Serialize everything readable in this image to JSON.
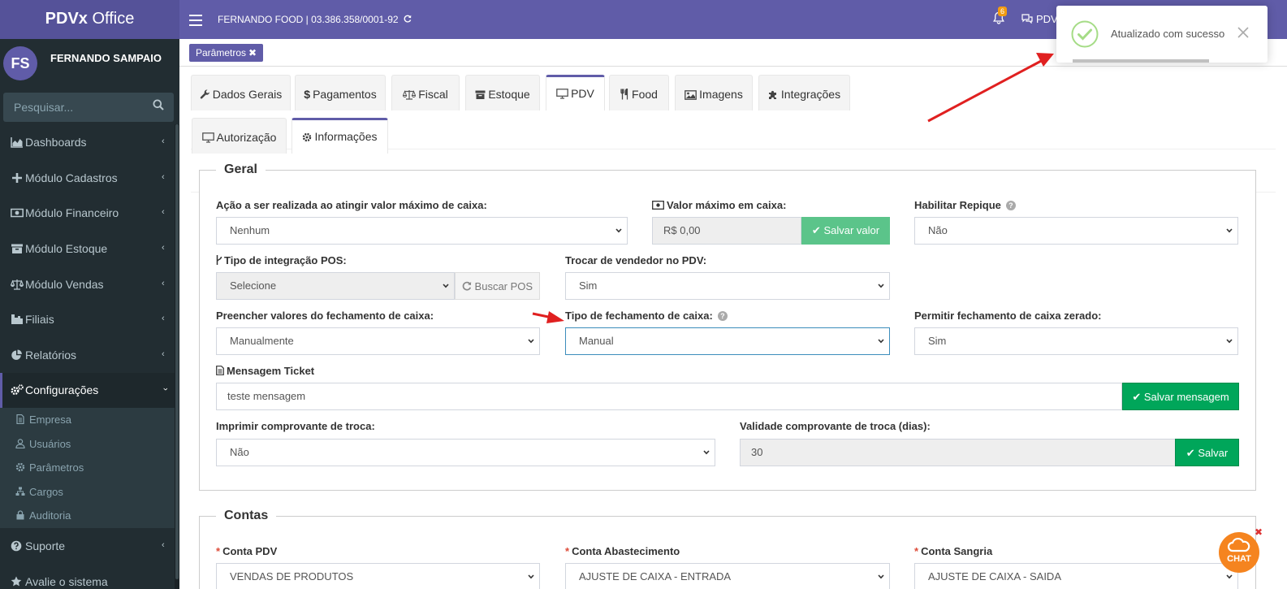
{
  "header": {
    "logo_bold": "PDVx",
    "logo_rest": " Office",
    "company": "FERNANDO FOOD | 03.386.358/0001-92",
    "notification_count": "6",
    "user_short": "PDVi"
  },
  "sidebar": {
    "avatar_initials": "FS",
    "user_name": "FERNANDO SAMPAIO",
    "search_placeholder": "Pesquisar...",
    "items": [
      {
        "label": "Dashboards",
        "icon": "area-chart-icon"
      },
      {
        "label": "Módulo Cadastros",
        "icon": "plus-icon"
      },
      {
        "label": "Módulo Financeiro",
        "icon": "money-icon"
      },
      {
        "label": "Módulo Estoque",
        "icon": "archive-icon"
      },
      {
        "label": "Módulo Vendas",
        "icon": "balance-scale-icon"
      },
      {
        "label": "Filiais",
        "icon": "building-icon"
      },
      {
        "label": "Relatórios",
        "icon": "pie-chart-icon"
      },
      {
        "label": "Configurações",
        "icon": "cogs-icon"
      }
    ],
    "submenu": [
      {
        "label": "Empresa",
        "icon": "file-icon"
      },
      {
        "label": "Usuários",
        "icon": "user-icon"
      },
      {
        "label": "Parâmetros",
        "icon": "gear-icon"
      },
      {
        "label": "Cargos",
        "icon": "sitemap-icon"
      },
      {
        "label": "Auditoria",
        "icon": "lock-icon"
      }
    ],
    "suporte": "Suporte",
    "avalie": "Avalie o sistema"
  },
  "breadcrumb": {
    "tag": "Parâmetros"
  },
  "tabs_main": [
    "Dados Gerais",
    "Pagamentos",
    "Fiscal",
    "Estoque",
    "PDV",
    "Food",
    "Imagens",
    "Integrações"
  ],
  "tabs_sub": [
    "Autorização",
    "Informações"
  ],
  "geral": {
    "legend": "Geral",
    "acao_label": "Ação a ser realizada ao atingir valor máximo de caixa:",
    "acao_value": "Nenhum",
    "valor_max_label": "Valor máximo em caixa:",
    "valor_max_value": "R$ 0,00",
    "salvar_valor": "Salvar valor",
    "repique_label": "Habilitar Repique",
    "repique_value": "Não",
    "pos_label": "Tipo de integração POS:",
    "pos_value": "Selecione",
    "buscar_pos": "Buscar POS",
    "trocar_label": "Trocar de vendedor no PDV:",
    "trocar_value": "Sim",
    "preencher_label": "Preencher valores do fechamento de caixa:",
    "preencher_value": "Manualmente",
    "tipo_fech_label": "Tipo de fechamento de caixa:",
    "tipo_fech_value": "Manual",
    "zerado_label": "Permitir fechamento de caixa zerado:",
    "zerado_value": "Sim",
    "mensagem_label": "Mensagem Ticket",
    "mensagem_value": "teste mensagem",
    "salvar_mensagem": "Salvar mensagem",
    "imprimir_label": "Imprimir comprovante de troca:",
    "imprimir_value": "Não",
    "validade_label": "Validade comprovante de troca (dias):",
    "validade_value": "30",
    "salvar": "Salvar"
  },
  "contas": {
    "legend": "Contas",
    "pdv_label": "Conta PDV",
    "pdv_value": "VENDAS DE PRODUTOS",
    "abast_label": "Conta Abastecimento",
    "abast_value": "AJUSTE DE CAIXA - ENTRADA",
    "sangria_label": "Conta Sangria",
    "sangria_value": "AJUSTE DE CAIXA - SAIDA"
  },
  "toast": {
    "message": "Atualizado com sucesso"
  },
  "chat": {
    "label": "CHAT"
  },
  "colors": {
    "primary": "#605ca8",
    "sidebar": "#222d32",
    "success": "#00a65a",
    "annotation": "#e02020"
  }
}
